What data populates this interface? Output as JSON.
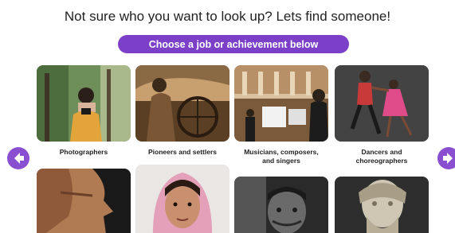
{
  "headline": "Not sure who you want to look up? Lets find someone!",
  "cta_label": "Choose a job or achievement below",
  "colors": {
    "accent": "#7b3fc8",
    "arrow": "#8a4fd0",
    "text": "#222222"
  },
  "nav": {
    "prev_icon": "arrow-left-icon",
    "next_icon": "arrow-right-icon"
  },
  "categories": [
    {
      "label": "Photographers"
    },
    {
      "label": "Pioneers and settlers"
    },
    {
      "label_line1": "Musicians, composers,",
      "label_line2": "and singers"
    },
    {
      "label_line1": "Dancers and",
      "label_line2": "choreographers"
    }
  ]
}
